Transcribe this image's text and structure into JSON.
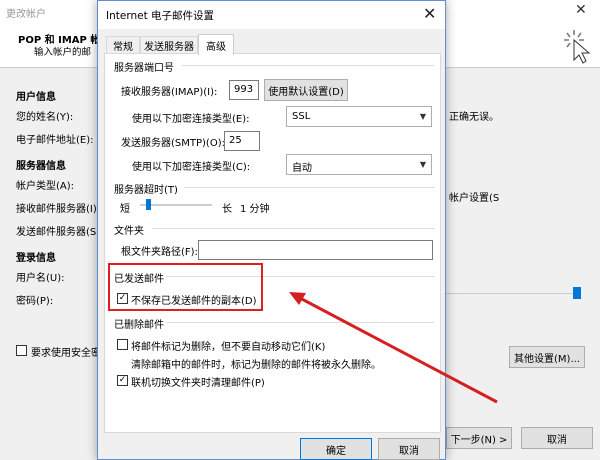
{
  "background_window": {
    "title": "更改帐户",
    "header_title": "POP 和 IMAP 帐",
    "header_subtitle": "输入帐户的邮",
    "section_user": "用户信息",
    "label_name": "您的姓名(Y):",
    "label_email": "电子邮件地址(E):",
    "section_server": "服务器信息",
    "label_account_type": "帐户类型(A):",
    "label_incoming": "接收邮件服务器(I):",
    "label_outgoing": "发送邮件服务器(SM",
    "section_login": "登录信息",
    "label_username": "用户名(U):",
    "label_password": "密码(P):",
    "require_secure": "要求使用安全密",
    "right_text_1": "正确无误。",
    "right_text_2": "帐户设置(S",
    "more_settings": "其他设置(M)...",
    "next_button": "下一步(N) >",
    "cancel_button": "取消"
  },
  "dialog": {
    "title": "Internet 电子邮件设置",
    "tabs": [
      {
        "label": "常规"
      },
      {
        "label": "发送服务器"
      },
      {
        "label": "高级",
        "active": true
      }
    ],
    "server_ports": {
      "section": "服务器端口号",
      "incoming_label": "接收服务器(IMAP)(I):",
      "incoming_port": "993",
      "use_defaults": "使用默认设置(D)",
      "incoming_encryption_label": "使用以下加密连接类型(E):",
      "incoming_encryption": "SSL",
      "outgoing_label": "发送服务器(SMTP)(O):",
      "outgoing_port": "25",
      "outgoing_encryption_label": "使用以下加密连接类型(C):",
      "outgoing_encryption": "自动"
    },
    "timeout": {
      "section": "服务器超时(T)",
      "short": "短",
      "long": "长",
      "value": "1 分钟"
    },
    "folders": {
      "section": "文件夹",
      "root_label": "根文件夹路径(F):",
      "root_value": ""
    },
    "sent_items": {
      "section": "已发送邮件",
      "dont_save": "不保存已发送邮件的副本(D)",
      "dont_save_checked": true
    },
    "deleted_items": {
      "section": "已删除邮件",
      "mark_for_deletion": "将邮件标记为删除，但不要自动移动它们(K)",
      "mark_checked": false,
      "purge_note": "清除邮箱中的邮件时，标记为删除的邮件将被永久删除。",
      "purge_on_switch": "联机切换文件夹时清理邮件(P)",
      "purge_checked": true
    },
    "ok_button": "确定",
    "cancel_button": "取消"
  },
  "annotation_color": "#e02020"
}
